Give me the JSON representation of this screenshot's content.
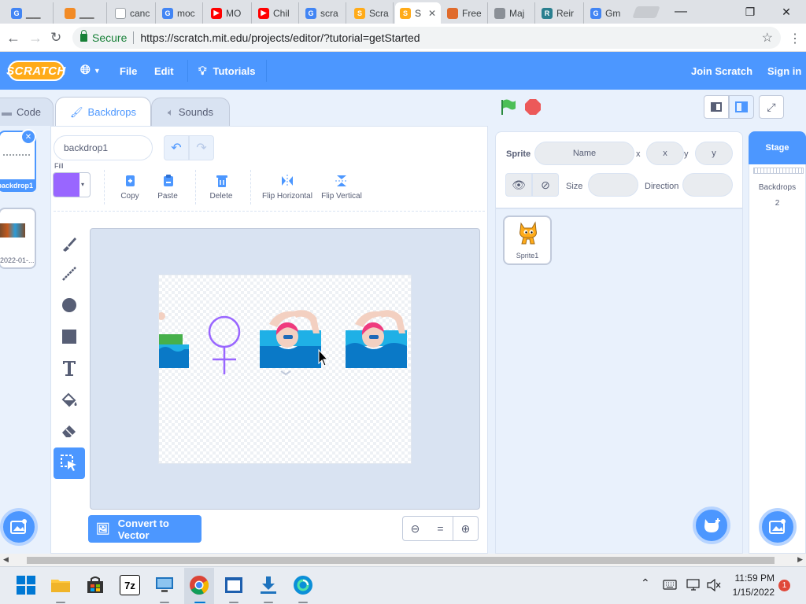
{
  "browser": {
    "tabs": [
      {
        "title": "",
        "icon": "google-icon",
        "color": "#4285f4"
      },
      {
        "title": "",
        "icon": "orange-icon",
        "color": "#f28b26"
      },
      {
        "title": "canc",
        "icon": "doc-icon",
        "color": "#9aa0a6"
      },
      {
        "title": "moc",
        "icon": "google-icon",
        "color": "#4285f4"
      },
      {
        "title": "MO",
        "icon": "youtube-icon",
        "color": "#ff0000"
      },
      {
        "title": "Chil",
        "icon": "youtube-icon",
        "color": "#ff0000"
      },
      {
        "title": "scra",
        "icon": "google-icon",
        "color": "#4285f4"
      },
      {
        "title": "Scra",
        "icon": "scratch-icon",
        "color": "#ffab19"
      },
      {
        "title": "S",
        "icon": "scratch-icon",
        "color": "#ffab19",
        "active": true
      },
      {
        "title": "Free",
        "icon": "free-icon",
        "color": "#e06b2c"
      },
      {
        "title": "Maj",
        "icon": "maj-icon",
        "color": "#8a8f96"
      },
      {
        "title": "Reir",
        "icon": "reir-icon",
        "color": "#2a7f8f"
      },
      {
        "title": "Gm",
        "icon": "google-icon",
        "color": "#4285f4"
      }
    ],
    "window_controls": {
      "minimize": "—",
      "restore": "❐",
      "close": "✕"
    },
    "url_secure": "Secure",
    "url": "https://scratch.mit.edu/projects/editor/?tutorial=getStarted"
  },
  "menubar": {
    "logo": "SCRATCH",
    "file": "File",
    "edit": "Edit",
    "tutorials": "Tutorials",
    "join": "Join Scratch",
    "signin": "Sign in"
  },
  "tabs": {
    "code": "Code",
    "backdrops": "Backdrops",
    "sounds": "Sounds"
  },
  "costume_list": {
    "items": [
      {
        "label": "backdrop1",
        "selected": true
      },
      {
        "label": "2022-01-...",
        "selected": false
      }
    ]
  },
  "paint_editor": {
    "costume_name": "backdrop1",
    "fill_label": "Fill",
    "fill_color": "#9966ff",
    "actions": {
      "copy": "Copy",
      "paste": "Paste",
      "delete": "Delete",
      "flip_h": "Flip Horizontal",
      "flip_v": "Flip Vertical"
    },
    "tools": [
      "brush-icon",
      "line-icon",
      "circle-icon",
      "rectangle-icon",
      "text-icon",
      "fill-icon",
      "eraser-icon",
      "select-icon"
    ],
    "selected_tool": "select-icon",
    "convert_label": "Convert to Vector",
    "zoom": {
      "out": "−",
      "reset": "=",
      "in": "+"
    }
  },
  "sprite_info": {
    "sprite_label": "Sprite",
    "name_placeholder": "Name",
    "x_label": "x",
    "x_placeholder": "x",
    "y_label": "y",
    "y_placeholder": "y",
    "size_label": "Size",
    "direction_label": "Direction"
  },
  "sprites": [
    {
      "name": "Sprite1"
    }
  ],
  "stage_pane": {
    "header": "Stage",
    "backdrops_label": "Backdrops",
    "backdrops_count": "2"
  },
  "taskbar": {
    "time": "11:59 PM",
    "date": "1/15/2022",
    "notification_count": "1",
    "apps": [
      "windows-start-icon",
      "file-explorer-icon",
      "store-icon",
      "7zip-icon",
      "remote-icon",
      "chrome-icon",
      "app-icon",
      "download-icon",
      "edge-icon"
    ]
  },
  "colors": {
    "scratch_blue": "#4c97ff",
    "editor_bg": "#e9f1fc",
    "taskbar_bg": "#e8ecf2"
  }
}
